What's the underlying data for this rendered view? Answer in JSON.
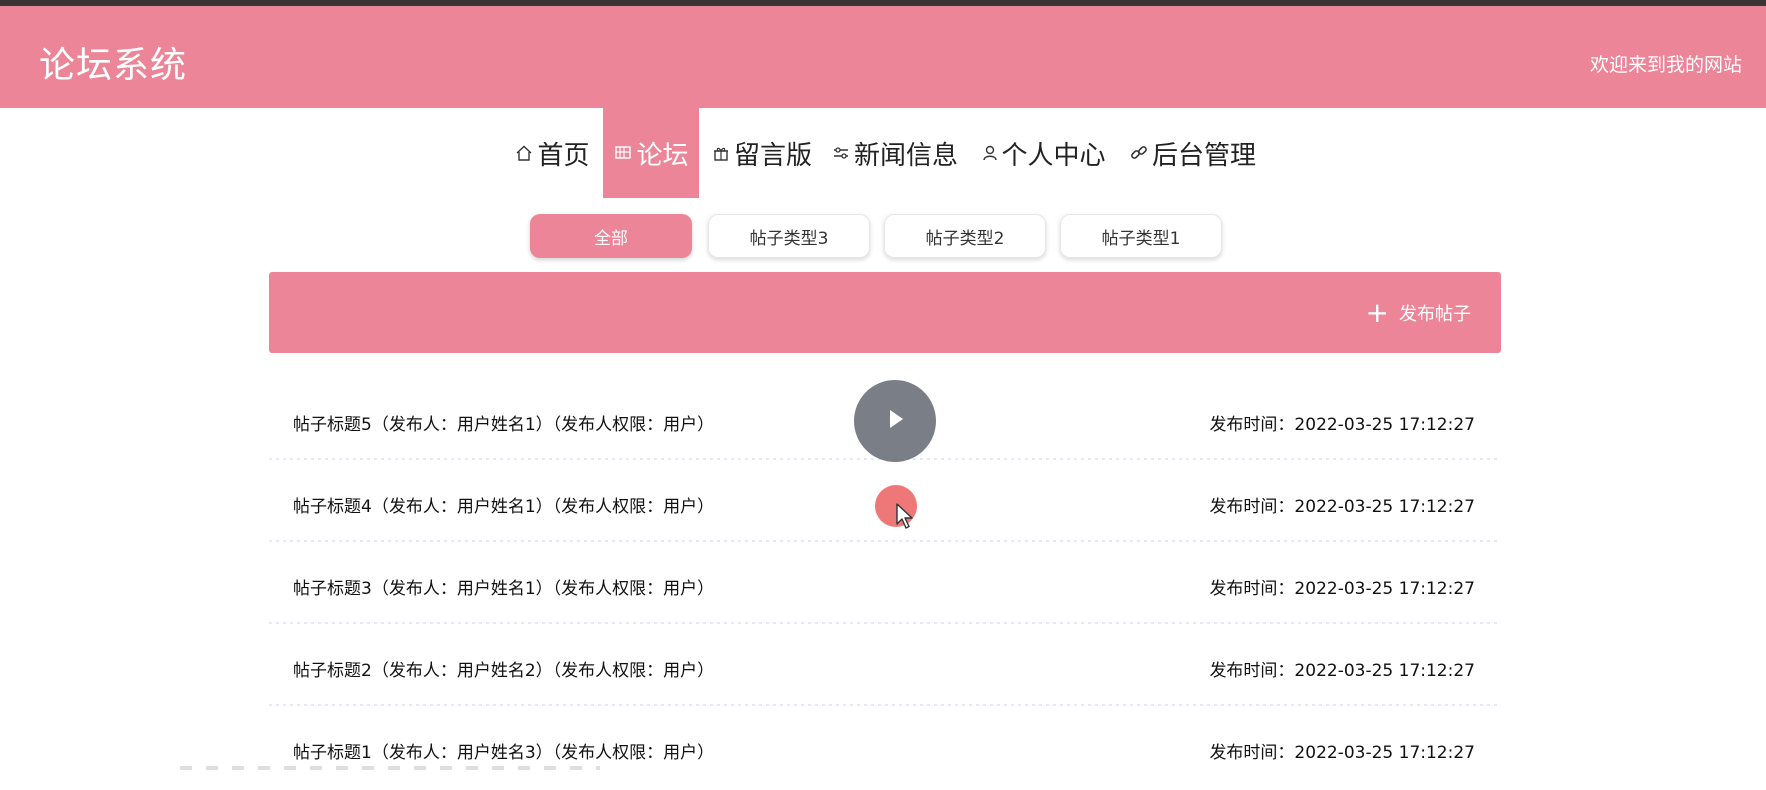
{
  "header": {
    "site_title": "论坛系统",
    "welcome": "欢迎来到我的网站",
    "background_color": "#eb8597"
  },
  "nav": {
    "items": [
      {
        "label": "首页",
        "icon": "home-icon"
      },
      {
        "label": "论坛",
        "icon": "forum-icon",
        "active": true
      },
      {
        "label": "留言版",
        "icon": "gift-icon"
      },
      {
        "label": "新闻信息",
        "icon": "sliders-icon"
      },
      {
        "label": "个人中心",
        "icon": "user-icon"
      },
      {
        "label": "后台管理",
        "icon": "link-icon"
      }
    ]
  },
  "filters": {
    "items": [
      {
        "label": "全部",
        "active": true
      },
      {
        "label": "帖子类型3"
      },
      {
        "label": "帖子类型2"
      },
      {
        "label": "帖子类型1"
      }
    ]
  },
  "banner": {
    "publish_label": "发布帖子",
    "publish_icon": "plus-icon"
  },
  "posts": [
    {
      "title": "帖子标题5（发布人：用户姓名1）（发布人权限：用户）",
      "time": "发布时间：2022-03-25 17:12:27"
    },
    {
      "title": "帖子标题4（发布人：用户姓名1）（发布人权限：用户）",
      "time": "发布时间：2022-03-25 17:12:27"
    },
    {
      "title": "帖子标题3（发布人：用户姓名1）（发布人权限：用户）",
      "time": "发布时间：2022-03-25 17:12:27"
    },
    {
      "title": "帖子标题2（发布人：用户姓名2）（发布人权限：用户）",
      "time": "发布时间：2022-03-25 17:12:27"
    },
    {
      "title": "帖子标题1（发布人：用户姓名3）（发布人权限：用户）",
      "time": "发布时间：2022-03-25 17:12:27"
    }
  ],
  "overlay": {
    "play_icon": "play-icon",
    "cursor_icon": "mouse-cursor-icon"
  }
}
